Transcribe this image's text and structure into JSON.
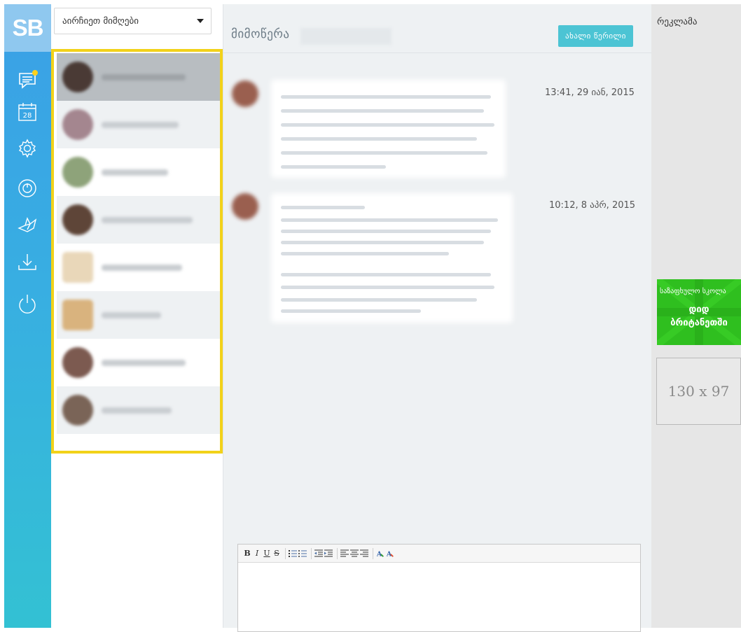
{
  "app": {
    "logo": "SB"
  },
  "rail": {
    "items": [
      {
        "name": "messages-icon",
        "has_badge": true
      },
      {
        "name": "calendar-icon",
        "label": "28"
      },
      {
        "name": "settings-icon"
      },
      {
        "name": "power-timer-icon"
      },
      {
        "name": "origami-bird-icon"
      },
      {
        "name": "download-icon"
      },
      {
        "name": "logout-icon"
      }
    ]
  },
  "contacts": {
    "filter_label": "აირჩიეთ მიმღები",
    "items_count": 8
  },
  "main": {
    "title": "მიმოწერა",
    "new_message_label": "ახალი წერილი",
    "messages": [
      {
        "time": "13:41, 29 იან, 2015"
      },
      {
        "time": "10:12, 8 აპრ, 2015"
      }
    ]
  },
  "ads": {
    "title": "რეკლამა",
    "banner_line1": "საზაფხულო სკოლა",
    "banner_line2": "დიდ",
    "banner_line3": "ბრიტანეთში",
    "placeholder_label": "130 x 97"
  },
  "colors": {
    "rail_top": "#3aa0e6",
    "rail_bottom": "#33c1d3",
    "highlight_frame": "#f2d21a",
    "accent_button": "#4cc4d4",
    "banner": "#2fbf1f"
  }
}
